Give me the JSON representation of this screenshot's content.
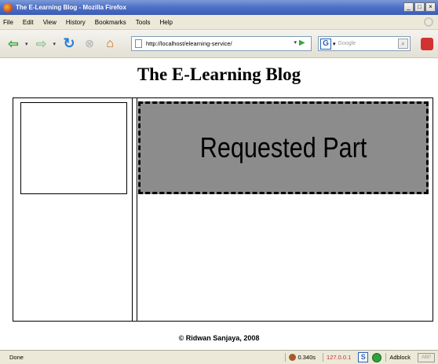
{
  "window": {
    "title": "The E-Learning Blog - Mozilla Firefox",
    "controls": [
      "_",
      "□",
      "×"
    ]
  },
  "menu": {
    "items": [
      "File",
      "Edit",
      "View",
      "History",
      "Bookmarks",
      "Tools",
      "Help"
    ]
  },
  "navbar": {
    "url": "http://localhost/elearning-service/",
    "search_placeholder": "Google",
    "search_engine_letter": "G"
  },
  "page": {
    "title": "The E-Learning Blog",
    "requested_part": "Requested Part",
    "footer": "© Ridwan Sanjaya, 2008"
  },
  "status": {
    "text": "Done",
    "load_time": "0.340s",
    "ip": "127.0.0.1",
    "s_icon_letter": "S",
    "adblock": "Adblock"
  },
  "colors": {
    "requested_bg": "#8c8c8c",
    "titlebar": "#4d6fc4"
  }
}
